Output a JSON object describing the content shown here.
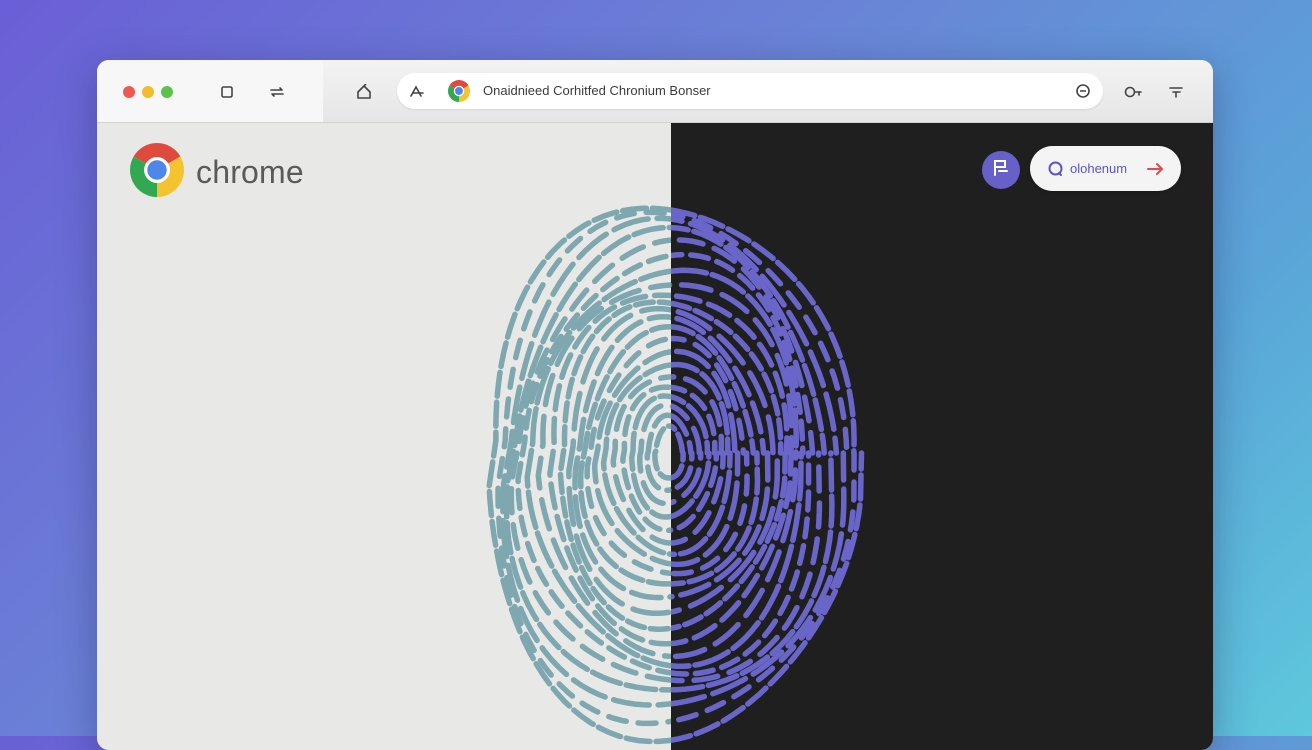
{
  "toolbar": {
    "window_controls": [
      "close",
      "minimize",
      "maximize"
    ],
    "nav_icons": [
      "tab-square-icon",
      "swap-icon",
      "home-icon"
    ],
    "omnibox": {
      "site_icon": "chrome-logo-icon",
      "text": "Onaidnieed Corhitfed Chronium Bonser",
      "right_icon": "refresh-icon"
    },
    "extras": [
      "key-icon",
      "menu-icon"
    ]
  },
  "page": {
    "brand_text": "chrome",
    "avatar_icon": "profile-badge-icon",
    "pill": {
      "label": "olohenum",
      "icon": "search-circle-icon",
      "arrow_icon": "arrow-right-icon"
    }
  },
  "colors": {
    "left_bg": "#e8e8e7",
    "right_bg": "#1f1f1f",
    "fingerprint_left": "#7ea7b0",
    "fingerprint_right": "#6a66c9",
    "accent": "#6660c8",
    "arrow": "#e5484d"
  }
}
